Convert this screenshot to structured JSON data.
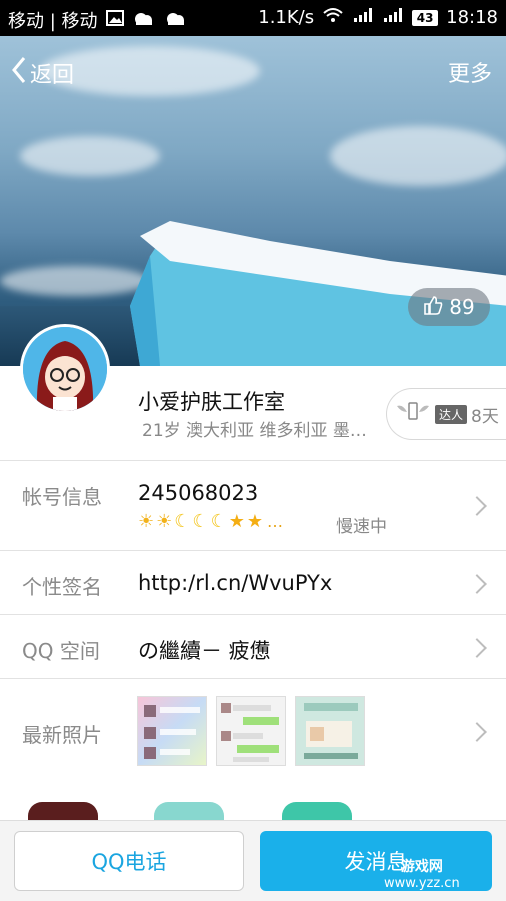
{
  "status_bar": {
    "carrier": "移动 | 移动",
    "speed": "1.1K/s",
    "battery": "43",
    "time": "18:18"
  },
  "header": {
    "back_label": "返回",
    "more_label": "更多",
    "likes": "89"
  },
  "profile": {
    "name": "小爱护肤工作室",
    "meta": "21岁 澳大利亚 维多利亚 墨…",
    "expert_tag": "达人",
    "expert_days": "8天"
  },
  "rows": {
    "account": {
      "label": "帐号信息",
      "value": "245068023",
      "speed": "慢速中"
    },
    "signature": {
      "label": "个性签名",
      "value": "http:/rl.cn/WvuPYx"
    },
    "qzone": {
      "label": "QQ 空间",
      "value": "の繼續－ 疲憊"
    },
    "photos": {
      "label": "最新照片"
    }
  },
  "bottom": {
    "call_label": "QQ电话",
    "message_label": "发消息"
  },
  "watermark": {
    "brand": "游戏网",
    "url": "www.yzz.cn"
  },
  "colors": {
    "accent": "#1ab0ea",
    "label_gray": "#8a8a8a",
    "level_gold": "#f2b21b"
  }
}
